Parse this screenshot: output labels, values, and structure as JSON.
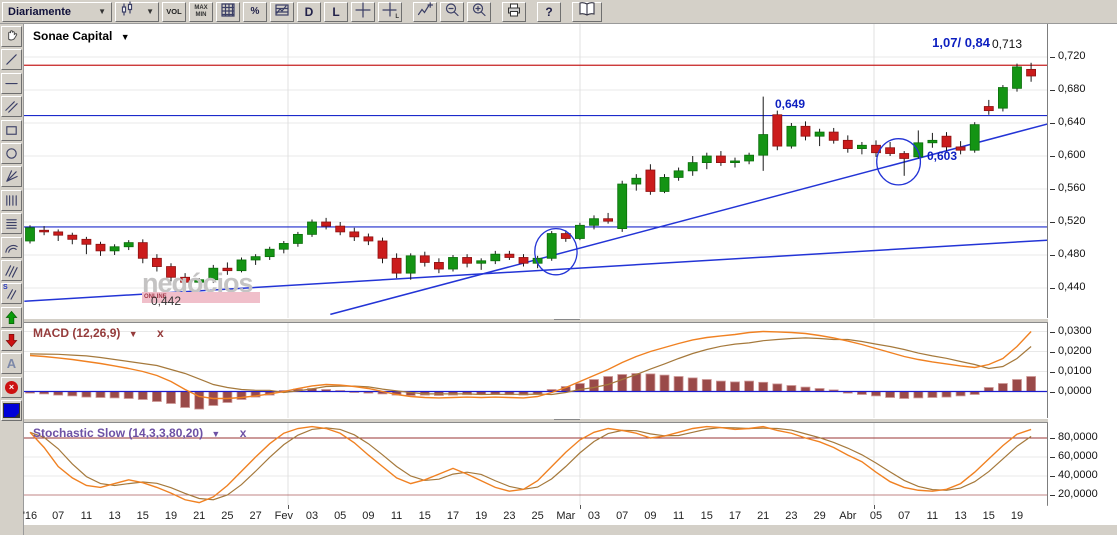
{
  "toolbar": {
    "period_value": "Diariamente",
    "buttons": {
      "vol": "VOL",
      "max": "MAX",
      "min": "MIN",
      "percent": "%",
      "d": "D",
      "l": "L",
      "help": "?"
    }
  },
  "icons": {
    "caret_down": "▼",
    "close_x": "x",
    "text_tool": "A",
    "speed_s": "S",
    "multiply_x": "×",
    "sub_l": "L"
  },
  "sidebar": {
    "tools": [
      "pan-hand",
      "trend-line",
      "horizontal-line",
      "parallel-lines",
      "rectangle",
      "ellipse",
      "gann-fan",
      "fibonacci-time-zones",
      "fibonacci-retracement",
      "fibonacci-arc",
      "speed-lines",
      "speed-resistance-lines",
      "arrow-up-marker",
      "arrow-down-marker",
      "text-annotation",
      "delete-drawing",
      "color-picker"
    ]
  },
  "chart": {
    "title": "Sonae Capital",
    "annotations": {
      "price_targets": "1,07/ 0,84",
      "last_price": "0,713",
      "resistance_level": "0,649",
      "trend_level": "0,603",
      "low_label": "0,442"
    },
    "watermark": {
      "text": "negócios",
      "badge": "ONLINE"
    },
    "y_axis_labels": [
      "0,720",
      "0,680",
      "0,640",
      "0,600",
      "0,560",
      "0,520",
      "0,480",
      "0,440"
    ]
  },
  "macd": {
    "title": "MACD (12,26,9)",
    "y_axis_labels": [
      "0,0300",
      "0,0200",
      "0,0100",
      "0,0000"
    ]
  },
  "stochastic": {
    "title": "Stochastic Slow (14,3,3,80,20)",
    "y_axis_labels": [
      "80,0000",
      "60,0000",
      "40,0000",
      "20,0000"
    ]
  },
  "x_axis_labels": [
    "'16",
    "07",
    "11",
    "13",
    "15",
    "19",
    "21",
    "25",
    "27",
    "Fev",
    "03",
    "05",
    "09",
    "11",
    "15",
    "17",
    "19",
    "23",
    "25",
    "Mar",
    "03",
    "07",
    "09",
    "11",
    "15",
    "17",
    "21",
    "23",
    "29",
    "Abr",
    "05",
    "07",
    "11",
    "13",
    "15",
    "19"
  ],
  "chart_data": {
    "type": "candlestick",
    "symbol": "Sonae Capital",
    "timeframe": "Diariamente",
    "price_ylim": [
      0.404,
      0.76
    ],
    "price_yticks": [
      0.72,
      0.68,
      0.64,
      0.6,
      0.56,
      0.52,
      0.48,
      0.44
    ],
    "candles": [
      [
        0.497,
        0.516,
        0.494,
        0.513
      ],
      [
        0.51,
        0.515,
        0.504,
        0.508
      ],
      [
        0.508,
        0.511,
        0.497,
        0.504
      ],
      [
        0.504,
        0.507,
        0.493,
        0.499
      ],
      [
        0.499,
        0.502,
        0.481,
        0.493
      ],
      [
        0.493,
        0.496,
        0.479,
        0.485
      ],
      [
        0.485,
        0.493,
        0.48,
        0.49
      ],
      [
        0.49,
        0.498,
        0.486,
        0.495
      ],
      [
        0.495,
        0.499,
        0.47,
        0.476
      ],
      [
        0.476,
        0.481,
        0.46,
        0.466
      ],
      [
        0.466,
        0.47,
        0.448,
        0.453
      ],
      [
        0.453,
        0.458,
        0.442,
        0.447
      ],
      [
        0.447,
        0.452,
        0.443,
        0.45
      ],
      [
        0.45,
        0.468,
        0.446,
        0.464
      ],
      [
        0.464,
        0.471,
        0.456,
        0.461
      ],
      [
        0.461,
        0.477,
        0.459,
        0.474
      ],
      [
        0.474,
        0.481,
        0.468,
        0.478
      ],
      [
        0.478,
        0.49,
        0.474,
        0.487
      ],
      [
        0.487,
        0.497,
        0.482,
        0.494
      ],
      [
        0.494,
        0.508,
        0.49,
        0.505
      ],
      [
        0.505,
        0.523,
        0.502,
        0.52
      ],
      [
        0.52,
        0.525,
        0.511,
        0.515
      ],
      [
        0.515,
        0.52,
        0.504,
        0.508
      ],
      [
        0.508,
        0.513,
        0.497,
        0.502
      ],
      [
        0.502,
        0.506,
        0.492,
        0.497
      ],
      [
        0.497,
        0.501,
        0.47,
        0.476
      ],
      [
        0.476,
        0.482,
        0.452,
        0.458
      ],
      [
        0.458,
        0.482,
        0.45,
        0.479
      ],
      [
        0.479,
        0.484,
        0.466,
        0.471
      ],
      [
        0.471,
        0.476,
        0.458,
        0.463
      ],
      [
        0.463,
        0.48,
        0.46,
        0.477
      ],
      [
        0.477,
        0.481,
        0.465,
        0.47
      ],
      [
        0.47,
        0.476,
        0.462,
        0.473
      ],
      [
        0.473,
        0.485,
        0.469,
        0.481
      ],
      [
        0.481,
        0.485,
        0.474,
        0.477
      ],
      [
        0.477,
        0.481,
        0.466,
        0.47
      ],
      [
        0.47,
        0.479,
        0.464,
        0.476
      ],
      [
        0.476,
        0.509,
        0.473,
        0.506
      ],
      [
        0.506,
        0.51,
        0.496,
        0.5
      ],
      [
        0.5,
        0.519,
        0.498,
        0.516
      ],
      [
        0.516,
        0.528,
        0.511,
        0.524
      ],
      [
        0.524,
        0.531,
        0.518,
        0.521
      ],
      [
        0.512,
        0.57,
        0.508,
        0.566
      ],
      [
        0.566,
        0.578,
        0.558,
        0.573
      ],
      [
        0.583,
        0.59,
        0.553,
        0.557
      ],
      [
        0.557,
        0.578,
        0.555,
        0.574
      ],
      [
        0.574,
        0.586,
        0.57,
        0.582
      ],
      [
        0.582,
        0.6,
        0.576,
        0.592
      ],
      [
        0.592,
        0.604,
        0.584,
        0.6
      ],
      [
        0.6,
        0.606,
        0.588,
        0.592
      ],
      [
        0.592,
        0.598,
        0.586,
        0.594
      ],
      [
        0.594,
        0.604,
        0.59,
        0.601
      ],
      [
        0.601,
        0.672,
        0.582,
        0.626
      ],
      [
        0.65,
        0.655,
        0.607,
        0.612
      ],
      [
        0.612,
        0.64,
        0.609,
        0.636
      ],
      [
        0.636,
        0.642,
        0.619,
        0.624
      ],
      [
        0.624,
        0.633,
        0.612,
        0.629
      ],
      [
        0.629,
        0.634,
        0.615,
        0.619
      ],
      [
        0.619,
        0.625,
        0.604,
        0.609
      ],
      [
        0.609,
        0.617,
        0.602,
        0.613
      ],
      [
        0.613,
        0.619,
        0.599,
        0.604
      ],
      [
        0.61,
        0.617,
        0.6,
        0.603
      ],
      [
        0.603,
        0.606,
        0.576,
        0.597
      ],
      [
        0.599,
        0.631,
        0.597,
        0.616
      ],
      [
        0.616,
        0.628,
        0.61,
        0.619
      ],
      [
        0.624,
        0.629,
        0.606,
        0.611
      ],
      [
        0.611,
        0.618,
        0.602,
        0.607
      ],
      [
        0.607,
        0.641,
        0.604,
        0.638
      ],
      [
        0.66,
        0.668,
        0.65,
        0.655
      ],
      [
        0.658,
        0.686,
        0.654,
        0.683
      ],
      [
        0.682,
        0.712,
        0.678,
        0.708
      ],
      [
        0.705,
        0.713,
        0.69,
        0.697
      ]
    ],
    "levels": {
      "red_line": 0.71,
      "resistance": 0.649,
      "support": 0.514
    },
    "trendlines": [
      {
        "from": [
          -0.4,
          0.424
        ],
        "to": [
          72.2,
          0.498
        ]
      },
      {
        "from": [
          21.3,
          0.408
        ],
        "to": [
          72.2,
          0.639
        ]
      }
    ],
    "ellipses": [
      {
        "i": 37.3,
        "p": 0.484,
        "rx": 1.5,
        "rp": 0.028
      },
      {
        "i": 61.6,
        "p": 0.593,
        "rx": 1.55,
        "rp": 0.028
      }
    ],
    "macd": {
      "yticks": [
        0.03,
        0.02,
        0.01,
        0.0
      ],
      "line": [
        0.018,
        0.0175,
        0.0168,
        0.016,
        0.015,
        0.014,
        0.0128,
        0.0115,
        0.01,
        0.008,
        0.005,
        0.001,
        -0.0025,
        -0.0035,
        -0.0035,
        -0.003,
        -0.0022,
        -0.0012,
        0,
        0.0015,
        0.0028,
        0.0035,
        0.0032,
        0.0025,
        0.0015,
        0,
        -0.0015,
        -0.0025,
        -0.003,
        -0.0032,
        -0.003,
        -0.0028,
        -0.003,
        -0.0028,
        -0.003,
        -0.0032,
        -0.0025,
        -0.0005,
        0.002,
        0.005,
        0.008,
        0.011,
        0.0145,
        0.0175,
        0.02,
        0.022,
        0.024,
        0.0258,
        0.027,
        0.0278,
        0.0285,
        0.0295,
        0.03,
        0.0298,
        0.0295,
        0.029,
        0.028,
        0.0268,
        0.0252,
        0.0235,
        0.0215,
        0.0195,
        0.0175,
        0.016,
        0.0148,
        0.0138,
        0.0128,
        0.012,
        0.0135,
        0.0165,
        0.0225,
        0.03
      ],
      "histogram": [
        -0.0008,
        -0.0012,
        -0.0018,
        -0.0022,
        -0.0028,
        -0.003,
        -0.0032,
        -0.0035,
        -0.004,
        -0.005,
        -0.006,
        -0.008,
        -0.0088,
        -0.007,
        -0.0055,
        -0.004,
        -0.0028,
        -0.0018,
        0.0005,
        0.0012,
        0.0015,
        0.001,
        0.0005,
        -0.0002,
        -0.0008,
        -0.0012,
        -0.0018,
        -0.002,
        -0.0018,
        -0.002,
        -0.0018,
        -0.0016,
        -0.0015,
        -0.0014,
        -0.0016,
        -0.0018,
        -0.0012,
        0.001,
        0.0025,
        0.004,
        0.006,
        0.0075,
        0.0085,
        0.009,
        0.0088,
        0.0082,
        0.0075,
        0.0068,
        0.006,
        0.0052,
        0.0048,
        0.0052,
        0.0046,
        0.0038,
        0.003,
        0.0022,
        0.0015,
        0.0008,
        -0.0008,
        -0.0015,
        -0.0022,
        -0.003,
        -0.0035,
        -0.0032,
        -0.003,
        -0.0028,
        -0.0022,
        -0.0015,
        0.002,
        0.004,
        0.006,
        0.0075
      ]
    },
    "stochastic": {
      "yticks": [
        80,
        60,
        40,
        20
      ],
      "overbought": 80,
      "oversold": 20,
      "k": [
        86,
        70,
        50,
        38,
        30,
        28,
        32,
        36,
        33,
        28,
        22,
        15,
        12,
        18,
        30,
        45,
        60,
        74,
        85,
        90,
        92,
        90,
        85,
        75,
        62,
        50,
        38,
        32,
        36,
        42,
        48,
        42,
        35,
        28,
        24,
        26,
        35,
        50,
        65,
        78,
        86,
        90,
        88,
        85,
        80,
        82,
        86,
        90,
        92,
        91,
        89,
        90,
        92,
        88,
        85,
        80,
        76,
        70,
        62,
        55,
        44,
        34,
        28,
        25,
        24,
        26,
        32,
        44,
        58,
        72,
        84,
        89
      ]
    }
  }
}
